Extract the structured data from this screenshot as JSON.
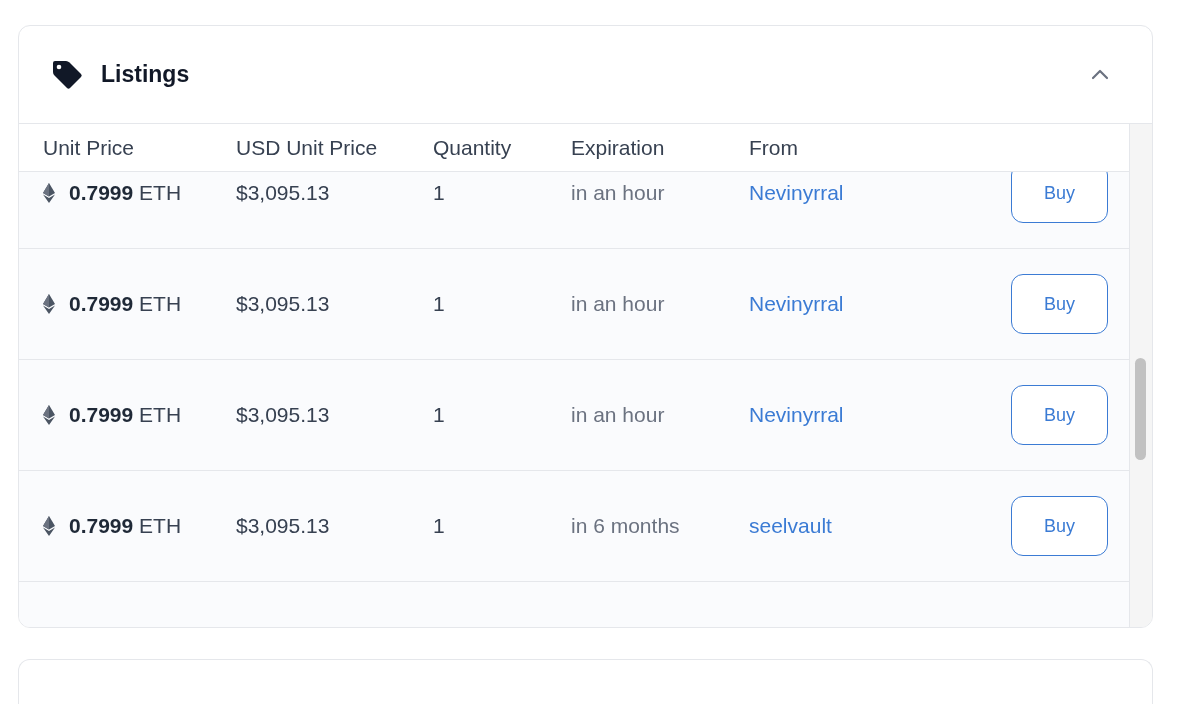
{
  "listings": {
    "title": "Listings",
    "expanded": true,
    "columns": [
      "Unit Price",
      "USD Unit Price",
      "Quantity",
      "Expiration",
      "From"
    ],
    "rows": [
      {
        "amount": "0.7999",
        "unit": "ETH",
        "usd": "$3,095.13",
        "quantity": "1",
        "expiration": "in an hour",
        "from": "Nevinyrral",
        "action": "Buy"
      },
      {
        "amount": "0.7999",
        "unit": "ETH",
        "usd": "$3,095.13",
        "quantity": "1",
        "expiration": "in an hour",
        "from": "Nevinyrral",
        "action": "Buy"
      },
      {
        "amount": "0.7999",
        "unit": "ETH",
        "usd": "$3,095.13",
        "quantity": "1",
        "expiration": "in an hour",
        "from": "Nevinyrral",
        "action": "Buy"
      },
      {
        "amount": "0.7999",
        "unit": "ETH",
        "usd": "$3,095.13",
        "quantity": "1",
        "expiration": "in 6 months",
        "from": "seelvault",
        "action": "Buy"
      }
    ]
  }
}
